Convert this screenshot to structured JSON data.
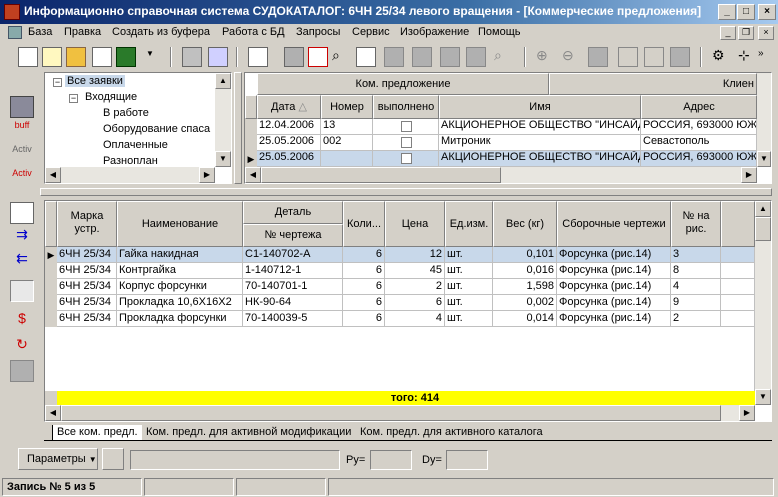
{
  "window": {
    "title": "Информационно справочная система СУДОКАТАЛОГ: 6ЧН 25/34 левого вращения - [Коммерческие предложения]",
    "min": "_",
    "max": "□",
    "close": "×"
  },
  "menu": [
    "База",
    "Правка",
    "Создать из буфера",
    "Работа с БД",
    "Запросы",
    "Сервис",
    "Изображение",
    "Помощь"
  ],
  "tree": {
    "root": "Все заявки",
    "group": "Входящие",
    "items": [
      "В работе",
      "Оборудование спаса",
      "Оплаченные",
      "Разноплан"
    ],
    "expander_open": "−"
  },
  "offers": {
    "group_header": "Ком. предложение",
    "client_header": "Клиен",
    "columns": [
      "Дата",
      "Номер",
      "выполнено",
      "Имя",
      "Адрес"
    ],
    "sort_mark": "△",
    "rows": [
      {
        "date": "12.04.2006",
        "num": "13",
        "done": false,
        "name": "АКЦИОНЕРНОЕ ОБЩЕСТВО \"ИНСАЙД",
        "addr": "РОССИЯ, 693000 ЮЖ"
      },
      {
        "date": "25.05.2006",
        "num": "002",
        "done": false,
        "name": "Митроник",
        "addr": "Севастополь"
      },
      {
        "date": "25.05.2006",
        "num": "",
        "done": false,
        "name": "АКЦИОНЕРНОЕ ОБЩЕСТВО \"ИНСАЙД",
        "addr": "РОССИЯ, 693000 ЮЖ"
      }
    ]
  },
  "details": {
    "headers": {
      "marka": "Марка устр.",
      "name": "Наименование",
      "detail": "Деталь",
      "drawing": "№ чертежа",
      "qty": "Коли...",
      "price": "Цена",
      "unit": "Ед.изм.",
      "weight": "Вес (кг)",
      "assembly": "Сборочные чертежи",
      "fig": "№ на рис."
    },
    "rows": [
      {
        "marka": "6ЧН 25/34",
        "name": "Гайка накидная",
        "drawing": "С1-140702-А",
        "qty": "6",
        "price": "12",
        "unit": "шт.",
        "weight": "0,101",
        "assembly": "Форсунка (рис.14)",
        "fig": "3"
      },
      {
        "marka": "6ЧН 25/34",
        "name": "Контргайка",
        "drawing": "1-140712-1",
        "qty": "6",
        "price": "45",
        "unit": "шт.",
        "weight": "0,016",
        "assembly": "Форсунка (рис.14)",
        "fig": "8"
      },
      {
        "marka": "6ЧН 25/34",
        "name": "Корпус форсунки",
        "drawing": "70-140701-1",
        "qty": "6",
        "price": "2",
        "unit": "шт.",
        "weight": "1,598",
        "assembly": "Форсунка (рис.14)",
        "fig": "4"
      },
      {
        "marka": "6ЧН 25/34",
        "name": "Прокладка 10,6X16X2",
        "drawing": "НК-90-64",
        "qty": "6",
        "price": "6",
        "unit": "шт.",
        "weight": "0,002",
        "assembly": "Форсунка (рис.14)",
        "fig": "9"
      },
      {
        "marka": "6ЧН 25/34",
        "name": "Прокладка форсунки",
        "drawing": "70-140039-5",
        "qty": "6",
        "price": "4",
        "unit": "шт.",
        "weight": "0,014",
        "assembly": "Форсунка (рис.14)",
        "fig": "2"
      }
    ],
    "total": "того: 414"
  },
  "tabs": [
    "Все ком. предл.",
    "Ком. предл. для активной модификации",
    "Ком. предл. для активного каталога"
  ],
  "bottom": {
    "params": "Параметры",
    "py": "Py=",
    "dy": "Dy="
  },
  "status": "Запись № 5 из 5",
  "icons_left": [
    "buff",
    "Activ",
    "Activ"
  ],
  "colors": {
    "title_start": "#0a246a",
    "selection": "#c8d8ea",
    "total": "#ffff00"
  }
}
